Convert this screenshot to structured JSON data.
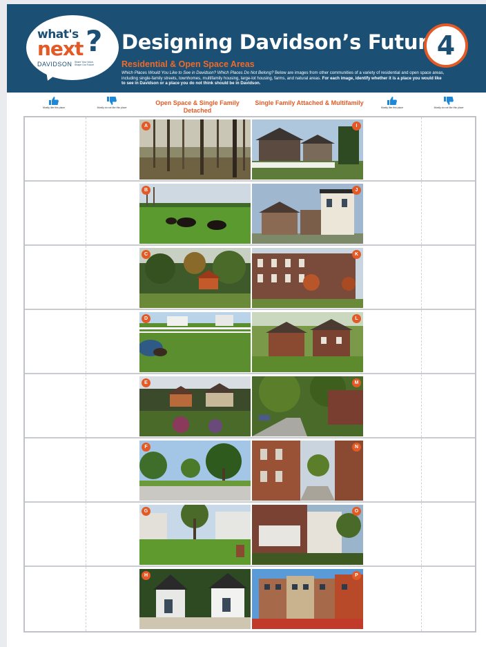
{
  "header": {
    "logo": {
      "whats": "what's",
      "next": "next",
      "q": "?",
      "town": "DAVIDSON",
      "tagline": "Share Your Voice, Shape Our Future"
    },
    "title": "Designing Davidson’s Future",
    "number": "4",
    "subtitle": "Residential & Open Space Areas",
    "intro_lead": "Which Places Would You Like to See in Davidson? Which Places Do Not Belong?",
    "intro_body": " Below are images from other communities of a variety of residential and open space areas, including single-family streets, townhomes, multifamily housing, large-lot housing, farms, and natural areas. ",
    "intro_bold": "For each image, identify whether it is a place you would like to see in Davidson or a place you do not think should be in Davidson."
  },
  "columns": {
    "like_caption": "Mostly like this place",
    "dislike_caption": "Mostly do not like this place",
    "left_heading": "Open Space & Single Family Detached",
    "right_heading": "Single Family Attached & Multifamily"
  },
  "colors": {
    "navy": "#1b4f74",
    "orange": "#e35a26"
  },
  "rows": [
    {
      "left": "A",
      "right": "I"
    },
    {
      "left": "B",
      "right": "J"
    },
    {
      "left": "C",
      "right": "K"
    },
    {
      "left": "D",
      "right": "L"
    },
    {
      "left": "E",
      "right": "M"
    },
    {
      "left": "F",
      "right": "N"
    },
    {
      "left": "G",
      "right": "O"
    },
    {
      "left": "H",
      "right": "P"
    }
  ]
}
